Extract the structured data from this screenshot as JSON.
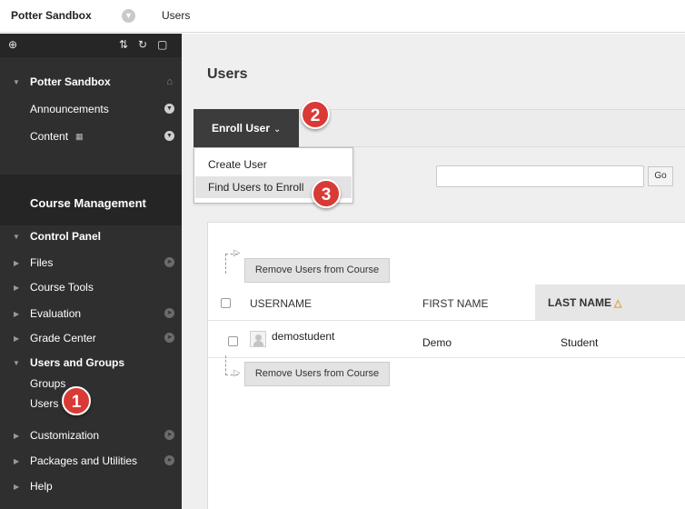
{
  "breadcrumb": {
    "course": "Potter Sandbox",
    "page": "Users"
  },
  "sidebar": {
    "course_name": "Potter Sandbox",
    "course_items": [
      "Announcements",
      "Content"
    ],
    "management_title": "Course Management",
    "control_panel": "Control Panel",
    "panel_items": {
      "files": "Files",
      "course_tools": "Course Tools",
      "evaluation": "Evaluation",
      "grade_center": "Grade Center",
      "users_and_groups": "Users and Groups",
      "groups": "Groups",
      "users": "Users",
      "customization": "Customization",
      "packages": "Packages and Utilities",
      "help": "Help"
    }
  },
  "main": {
    "title": "Users",
    "enroll_button": "Enroll User",
    "menu": [
      "Create User",
      "Find Users to Enroll"
    ],
    "go_button": "Go",
    "remove_button": "Remove Users from Course",
    "columns": {
      "username": "USERNAME",
      "first_name": "FIRST NAME",
      "last_name": "LAST NAME"
    },
    "rows": [
      {
        "username": "demostudent",
        "first_name": "Demo",
        "last_name": "Student"
      }
    ]
  },
  "callouts": {
    "one": "1",
    "two": "2",
    "three": "3"
  },
  "colors": {
    "sidebar": "#2f2f2f",
    "callout": "#d93a36",
    "enroll_button": "#3c3c3c"
  }
}
